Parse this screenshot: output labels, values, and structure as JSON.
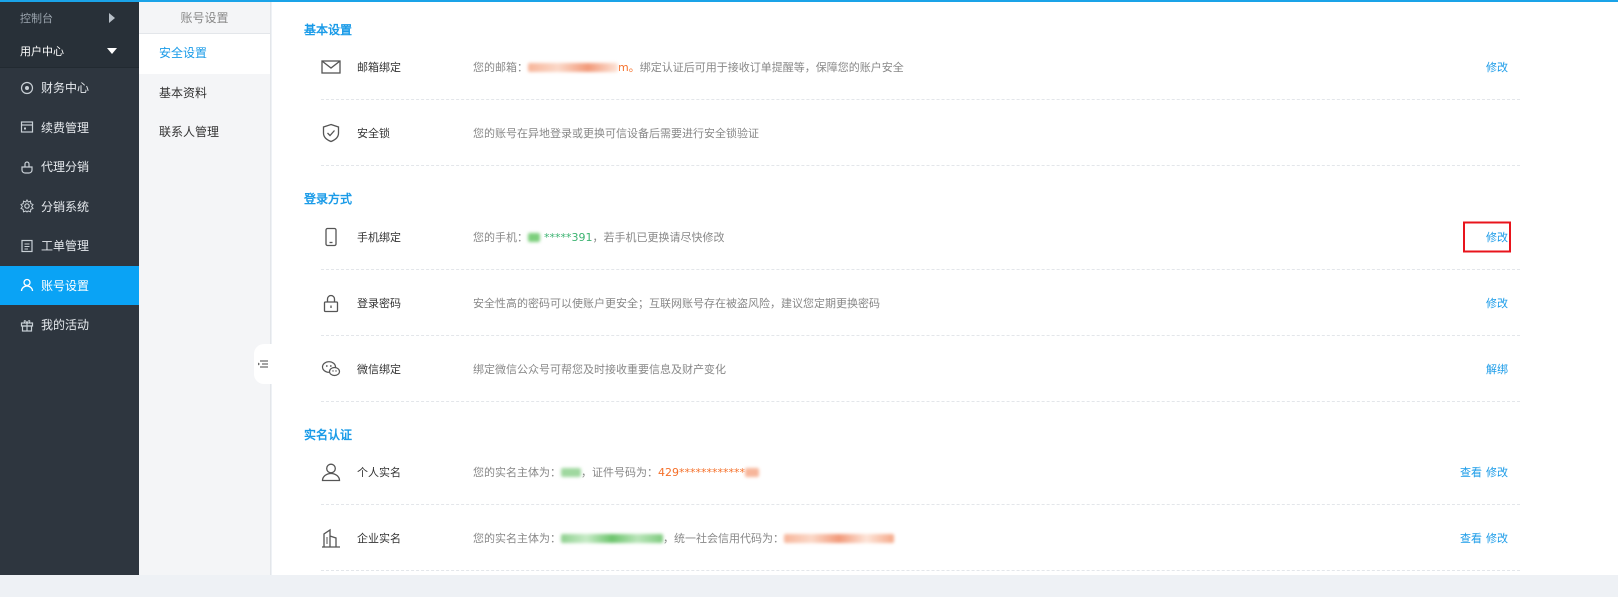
{
  "sidebar": {
    "console_label": "控制台",
    "user_center_label": "用户中心",
    "items": [
      {
        "label": "财务中心",
        "icon": "finance-icon"
      },
      {
        "label": "续费管理",
        "icon": "renewal-icon"
      },
      {
        "label": "代理分销",
        "icon": "agent-icon"
      },
      {
        "label": "分销系统",
        "icon": "gear-icon"
      },
      {
        "label": "工单管理",
        "icon": "ticket-icon"
      },
      {
        "label": "账号设置",
        "icon": "user-icon",
        "active": true
      },
      {
        "label": "我的活动",
        "icon": "gift-icon"
      }
    ]
  },
  "submenu": {
    "title": "账号设置",
    "items": [
      {
        "label": "安全设置",
        "active": true
      },
      {
        "label": "基本资料"
      },
      {
        "label": "联系人管理"
      }
    ]
  },
  "sections": {
    "basic": {
      "title": "基本设置",
      "email": {
        "name": "邮箱绑定",
        "desc_prefix": "您的邮箱：",
        "email_tail": "m。",
        "desc_suffix": "绑定认证后可用于接收订单提醒等，保障您的账户安全",
        "action": "修改"
      },
      "lock": {
        "name": "安全锁",
        "desc": "您的账号在异地登录或更换可信设备后需要进行安全锁验证"
      }
    },
    "login": {
      "title": "登录方式",
      "phone": {
        "name": "手机绑定",
        "desc_prefix": "您的手机：",
        "phone_masked": "*****391",
        "desc_suffix": "，若手机已更换请尽快修改",
        "action": "修改"
      },
      "password": {
        "name": "登录密码",
        "desc": "安全性高的密码可以使账户更安全；互联网账号存在被盗风险，建议您定期更换密码",
        "action": "修改"
      },
      "wechat": {
        "name": "微信绑定",
        "desc": "绑定微信公众号可帮您及时接收重要信息及财产变化",
        "action": "解绑"
      }
    },
    "realname": {
      "title": "实名认证",
      "personal": {
        "name": "个人实名",
        "desc_prefix": "您的实名主体为：",
        "desc_mid": "，证件号码为：",
        "id_prefix": "429************",
        "view": "查看",
        "edit": "修改"
      },
      "company": {
        "name": "企业实名",
        "desc_prefix": "您的实名主体为：",
        "desc_mid": "，统一社会信用代码为：",
        "view": "查看",
        "edit": "修改"
      }
    }
  },
  "colors": {
    "accent": "#0aa3f5",
    "link": "#1a9be8",
    "highlight": "#e8141c",
    "sidebar_bg": "#2e363f"
  }
}
